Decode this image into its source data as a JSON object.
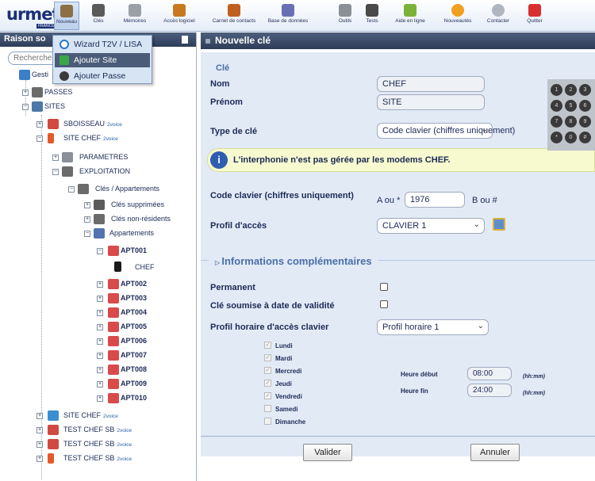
{
  "toolbar": {
    "logo": "urmet",
    "logo_sub": "FRANCE",
    "items": [
      {
        "label": "Nouveau",
        "icon": "new-icon",
        "color": "#8b6f45"
      },
      {
        "label": "Clés",
        "icon": "key-icon",
        "color": "#5a5a5a"
      },
      {
        "label": "Mémoires",
        "icon": "memory-icon",
        "color": "#9aa0a8"
      },
      {
        "label": "Accès logiciel",
        "icon": "users-icon",
        "color": "#c7791e"
      },
      {
        "label": "Carnet de contacts",
        "icon": "contacts-icon",
        "color": "#c06020"
      },
      {
        "label": "Base de données",
        "icon": "database-icon",
        "color": "#6a6fb5"
      },
      {
        "label": "Outils",
        "icon": "tools-icon",
        "color": "#8a8f98"
      },
      {
        "label": "Tests",
        "icon": "tests-icon",
        "color": "#4a4a4a"
      },
      {
        "label": "Aide en ligne",
        "icon": "help-icon",
        "color": "#7bb33a"
      },
      {
        "label": "Nouveautés",
        "icon": "news-icon",
        "color": "#f0a020"
      },
      {
        "label": "Contacter",
        "icon": "mail-icon",
        "color": "#b0b6c0"
      },
      {
        "label": "Quitter",
        "icon": "quit-icon",
        "color": "#d83030"
      }
    ]
  },
  "left_panel": {
    "title": "Raison so",
    "search_placeholder": "Recherche",
    "tree": [
      {
        "label": "Gesti",
        "icon": "network-icon"
      },
      {
        "label": "PASSES",
        "icon": "key-icon"
      },
      {
        "label": "SITES",
        "icon": "building-icon"
      },
      {
        "label": "SBOISSEAU",
        "icon": "site-icon",
        "badge": "2voice"
      },
      {
        "label": "SITE CHEF",
        "icon": "antenna-icon",
        "badge": "2voice"
      },
      {
        "label": "PARAMETRES",
        "icon": "settings-icon"
      },
      {
        "label": "EXPLOITATION",
        "icon": "exploitation-icon"
      },
      {
        "label": "Clés / Appartements",
        "icon": "keys-icon"
      },
      {
        "label": "Clés supprimées",
        "icon": "deleted-keys-icon"
      },
      {
        "label": "Clés non-résidents",
        "icon": "nonresident-keys-icon"
      },
      {
        "label": "Appartements",
        "icon": "apartments-icon"
      },
      {
        "label": "APT001",
        "icon": "apartment-icon"
      },
      {
        "label": "CHEF",
        "icon": "badge-key-icon"
      },
      {
        "label": "APT002",
        "icon": "apartment-icon"
      },
      {
        "label": "APT003",
        "icon": "apartment-icon"
      },
      {
        "label": "APT004",
        "icon": "apartment-icon"
      },
      {
        "label": "APT005",
        "icon": "apartment-icon"
      },
      {
        "label": "APT006",
        "icon": "apartment-icon"
      },
      {
        "label": "APT007",
        "icon": "apartment-icon"
      },
      {
        "label": "APT008",
        "icon": "apartment-icon"
      },
      {
        "label": "APT009",
        "icon": "apartment-icon"
      },
      {
        "label": "APT010",
        "icon": "apartment-icon"
      },
      {
        "label": "SITE CHEF",
        "icon": "site-icon",
        "badge": "2voice"
      },
      {
        "label": "TEST CHEF SB",
        "icon": "site-icon",
        "badge": "2voice"
      },
      {
        "label": "TEST CHEF SB",
        "icon": "site-icon",
        "badge": "2voice"
      },
      {
        "label": "TEST CHEF SB",
        "icon": "antenna-icon",
        "badge": "2voice"
      }
    ]
  },
  "dropdown": {
    "items": [
      {
        "label": "Wizard T2V / LISA",
        "icon": "wifi-icon"
      },
      {
        "label": "Ajouter Site",
        "icon": "add-site-icon"
      },
      {
        "label": "Ajouter Passe",
        "icon": "add-pass-icon"
      }
    ]
  },
  "form": {
    "header": "Nouvelle clé",
    "section_cle": "Clé",
    "nom_label": "Nom",
    "nom_value": "CHEF",
    "prenom_label": "Prénom",
    "prenom_value": "SITE",
    "type_label": "Type de clé",
    "type_value": "Code clavier (chiffres uniquement)",
    "info_message": "L'interphonie n'est pas gérée par les modems CHEF.",
    "code_label": "Code clavier (chiffres uniquement)",
    "code_a_label": "A ou *",
    "code_value": "1976",
    "code_b_label": "B ou #",
    "profil_label": "Profil d'accès",
    "profil_value": "CLAVIER 1",
    "section_info": "Informations complémentaires",
    "permanent_label": "Permanent",
    "validite_label": "Clé soumise à date de validité",
    "horaire_label": "Profil horaire d'accès clavier",
    "horaire_value": "Profil horaire 1",
    "days": [
      "Lundi",
      "Mardi",
      "Mercredi",
      "Jeudi",
      "Vendredi",
      "Samedi",
      "Dimanche"
    ],
    "heure_debut_label": "Heure début",
    "heure_debut_value": "08:00",
    "heure_fin_label": "Heure fin",
    "heure_fin_value": "24:00",
    "time_format": "(hh:mm)",
    "valider_label": "Valider",
    "annuler_label": "Annuler"
  },
  "keypad": [
    "1",
    "2",
    "3",
    "4",
    "5",
    "6",
    "7",
    "8",
    "9",
    "*",
    "0",
    "#"
  ]
}
